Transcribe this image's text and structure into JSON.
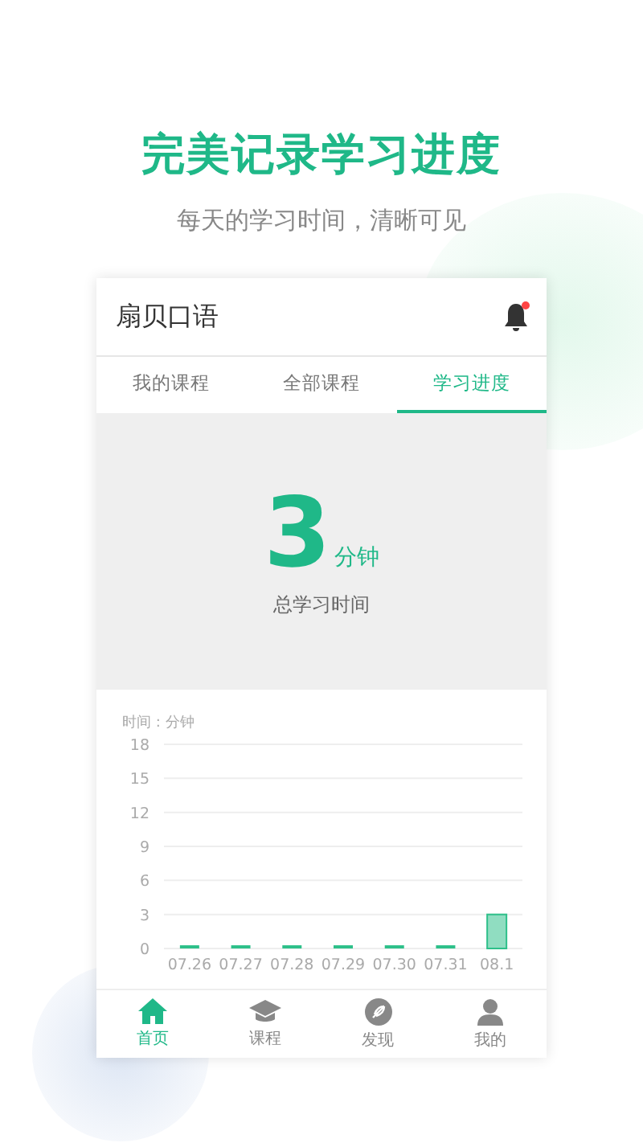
{
  "headline": "完美记录学习进度",
  "subtitle": "每天的学习时间，清晰可见",
  "app": {
    "title": "扇贝口语",
    "notification_dot": true
  },
  "tabs": [
    {
      "label": "我的课程",
      "selected": false
    },
    {
      "label": "全部课程",
      "selected": false
    },
    {
      "label": "学习进度",
      "selected": true
    }
  ],
  "summary": {
    "value": "3",
    "unit": "分钟",
    "caption": "总学习时间"
  },
  "chart": {
    "chart_data": {
      "type": "bar",
      "ylabel": "时间 : 分钟",
      "categories": [
        "07.26",
        "07.27",
        "07.28",
        "07.29",
        "07.30",
        "07.31",
        "08.1"
      ],
      "series": [
        {
          "color": "#2ec08a",
          "values": [
            0,
            0,
            0,
            0,
            0,
            0,
            3
          ]
        }
      ],
      "grid": true,
      "ylim": [
        0,
        18
      ],
      "yticks": [
        0,
        3,
        6,
        9,
        12,
        15,
        18
      ]
    }
  },
  "nav": [
    {
      "label": "首页",
      "kind": "home",
      "selected": true
    },
    {
      "label": "课程",
      "kind": "cap",
      "selected": false
    },
    {
      "label": "发现",
      "kind": "compass",
      "selected": false
    },
    {
      "label": "我的",
      "kind": "person",
      "selected": false
    }
  ]
}
